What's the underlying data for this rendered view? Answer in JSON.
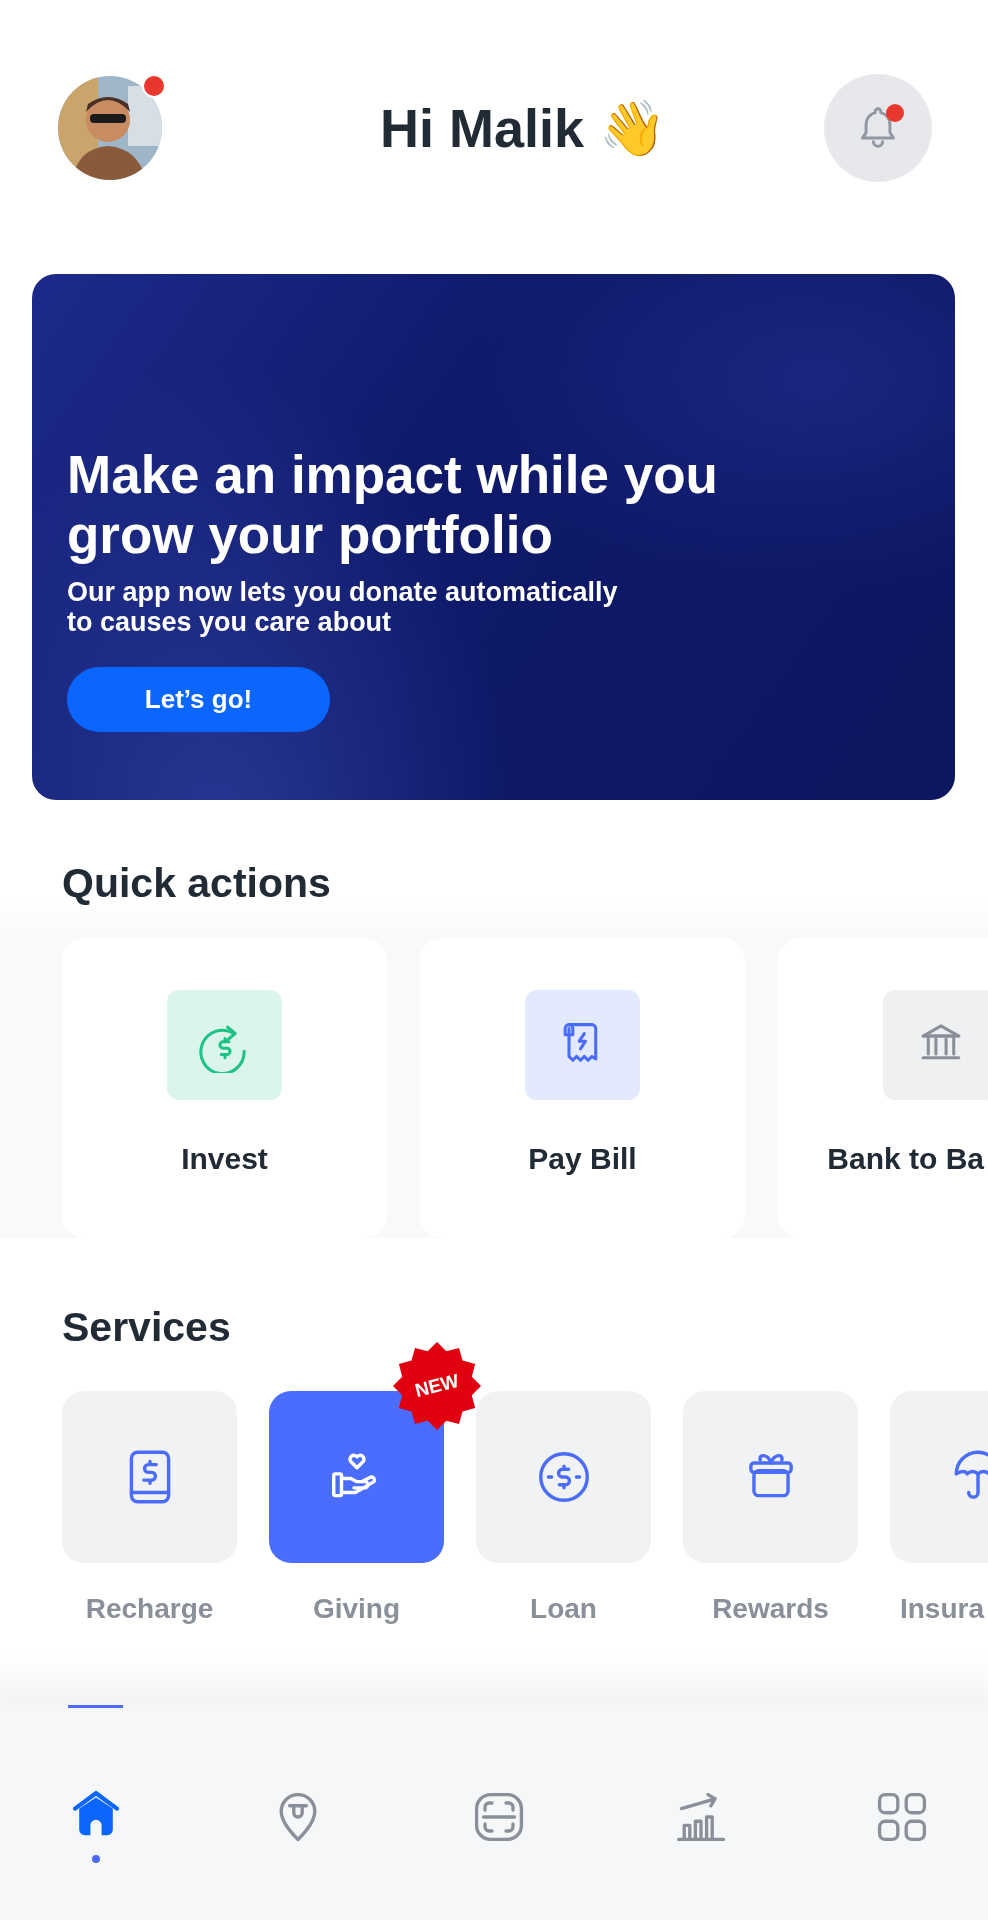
{
  "header": {
    "avatar": {
      "kind": "picture",
      "unread": true
    },
    "greeting": "Hi Malik 👋",
    "notifications": {
      "unread": true
    }
  },
  "banner": {
    "title": "Make an impact while you grow your portfolio",
    "text": "Our app now lets you donate automatically to causes you care about",
    "button": "Let’s go!"
  },
  "quick_actions": {
    "title": "Quick actions",
    "items": [
      {
        "label": "Invest"
      },
      {
        "label": "Pay Bill"
      },
      {
        "label": "Bank to Ba"
      }
    ]
  },
  "services": {
    "title": "Services",
    "items": [
      {
        "label": "Recharge",
        "selected": false
      },
      {
        "label": "Giving",
        "selected": true,
        "badge": "NEW"
      },
      {
        "label": "Loan",
        "selected": false
      },
      {
        "label": "Rewards",
        "selected": false
      },
      {
        "label": "Insura",
        "selected": false
      }
    ]
  },
  "bottom_nav": [
    {
      "selected": true
    },
    {
      "selected": false
    },
    {
      "selected": false
    },
    {
      "selected": false
    },
    {
      "selected": false
    }
  ]
}
